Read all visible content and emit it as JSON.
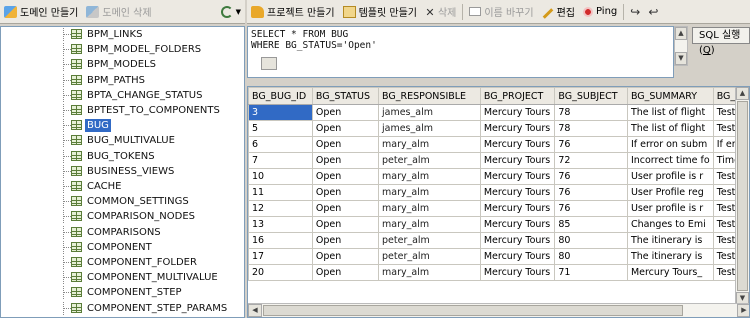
{
  "left_toolbar": {
    "create_domain": "도메인 만들기",
    "delete_domain": "도메인 삭제",
    "refresh_icon": "refresh-icon"
  },
  "right_toolbar": {
    "create_project": "프로젝트 만들기",
    "create_template": "템플릿 만들기",
    "delete": "삭제",
    "rename": "이름 바꾸기",
    "edit": "편집",
    "ping": "Ping"
  },
  "tree": {
    "selected_index": 6,
    "items": [
      "BPM_LINKS",
      "BPM_MODEL_FOLDERS",
      "BPM_MODELS",
      "BPM_PATHS",
      "BPTA_CHANGE_STATUS",
      "BPTEST_TO_COMPONENTS",
      "BUG",
      "BUG_MULTIVALUE",
      "BUG_TOKENS",
      "BUSINESS_VIEWS",
      "CACHE",
      "COMMON_SETTINGS",
      "COMPARISON_NODES",
      "COMPARISONS",
      "COMPONENT",
      "COMPONENT_FOLDER",
      "COMPONENT_MULTIVALUE",
      "COMPONENT_STEP",
      "COMPONENT_STEP_PARAMS"
    ]
  },
  "sql": {
    "query": "SELECT * FROM BUG\nWHERE BG_STATUS='Open'",
    "run_label": "SQL 실행",
    "run_key": "Q"
  },
  "grid": {
    "columns": [
      "BG_BUG_ID",
      "BG_STATUS",
      "BG_RESPONSIBLE",
      "BG_PROJECT",
      "BG_SUBJECT",
      "BG_SUMMARY",
      "BG_D"
    ],
    "selected_row": 0,
    "rows": [
      [
        "3",
        "Open",
        "james_alm",
        "Mercury Tours",
        "78",
        "The list of flight",
        "Test"
      ],
      [
        "5",
        "Open",
        "james_alm",
        "Mercury Tours",
        "78",
        "The list of flight",
        "Test"
      ],
      [
        "6",
        "Open",
        "mary_alm",
        "Mercury Tours",
        "76",
        "If error on subm",
        "If erro"
      ],
      [
        "7",
        "Open",
        "peter_alm",
        "Mercury Tours",
        "72",
        "Incorrect time fo",
        "Time"
      ],
      [
        "10",
        "Open",
        "mary_alm",
        "Mercury Tours",
        "76",
        "User profile is r",
        "Test"
      ],
      [
        "11",
        "Open",
        "mary_alm",
        "Mercury Tours",
        "76",
        "User Profile reg",
        "Test"
      ],
      [
        "12",
        "Open",
        "mary_alm",
        "Mercury Tours",
        "76",
        "User profile is r",
        "Test"
      ],
      [
        "13",
        "Open",
        "mary_alm",
        "Mercury Tours",
        "85",
        "Changes to Emi",
        "Test"
      ],
      [
        "16",
        "Open",
        "peter_alm",
        "Mercury Tours",
        "80",
        "The itinerary is",
        "Test"
      ],
      [
        "17",
        "Open",
        "peter_alm",
        "Mercury Tours",
        "80",
        "The itinerary is",
        "Test"
      ],
      [
        "20",
        "Open",
        "mary_alm",
        "Mercury Tours",
        "71",
        "Mercury Tours_",
        "Test"
      ]
    ]
  },
  "colors": {
    "selection": "#316ac5",
    "panel": "#d4d0c8",
    "border": "#7f9db9"
  }
}
